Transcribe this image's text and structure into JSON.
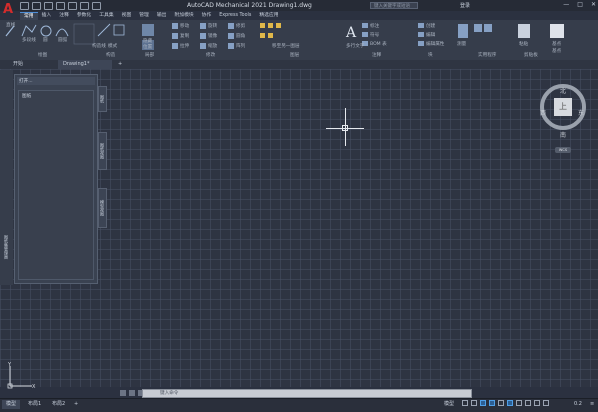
{
  "app": {
    "title": "AutoCAD Mechanical 2021   Drawing1.dwg",
    "search_placeholder": "键入关键字或短语",
    "login": "登录",
    "window_controls": [
      "—",
      "□",
      "✕"
    ]
  },
  "ribbon_tabs": [
    "常用",
    "插入",
    "注释",
    "参数化",
    "工具集",
    "视图",
    "管理",
    "输出",
    "附加模块",
    "协作",
    "Express Tools",
    "精选应用"
  ],
  "active_ribbon_tab": "常用",
  "ribbon_panels": {
    "draw": {
      "label": "绘图",
      "tools": [
        "直线",
        "多段线",
        "圆",
        "圆弧"
      ]
    },
    "construct": {
      "label": "构造",
      "tools": [
        "构造线",
        "模式"
      ]
    },
    "detail": {
      "label": "局部",
      "tools": [
        "隐藏",
        "位置"
      ]
    },
    "modify": {
      "label": "修改",
      "tools": [
        "移动",
        "旋转",
        "修剪",
        "复制",
        "镜像",
        "圆角",
        "拉伸",
        "缩放",
        "阵列"
      ]
    },
    "layers": {
      "label": "图层",
      "current_layer": "移至另一图层"
    },
    "annotation": {
      "label": "注释",
      "tools": [
        "多行文字",
        "标注",
        "符号",
        "BOM 表"
      ]
    },
    "block": {
      "label": "块",
      "tools": [
        "创建",
        "编辑",
        "编辑属性"
      ]
    },
    "utilities": {
      "label": "实用程序",
      "tools": [
        "测量"
      ]
    },
    "clipboard": {
      "label": "剪贴板",
      "tools": [
        "粘贴"
      ]
    },
    "base": {
      "label": "基点",
      "tools": [
        "基点"
      ]
    }
  },
  "document_tabs": [
    "开始",
    "Drawing1*"
  ],
  "active_document_tab": "Drawing1*",
  "tool_palette": {
    "open_label": "打开...",
    "tree_title": "图纸",
    "side_tabs": [
      "图纸",
      "图纸视图",
      "模型视图"
    ],
    "strip_title": "图纸集管理器"
  },
  "viewcube": {
    "north": "北",
    "south": "南",
    "east": "东",
    "west": "西",
    "face": "上",
    "wcs": "WCS"
  },
  "ucs": {
    "x": "X",
    "y": "Y"
  },
  "command_line": {
    "placeholder": "键入命令"
  },
  "status": {
    "layout_tabs": [
      "模型",
      "布局1",
      "布局2"
    ],
    "active_layout": "模型",
    "model_label": "模型",
    "scale": "0.2"
  },
  "colors": {
    "accent": "#4f8fd8",
    "logo": "#d22c2c",
    "canvas_bg": "#2e3442"
  }
}
